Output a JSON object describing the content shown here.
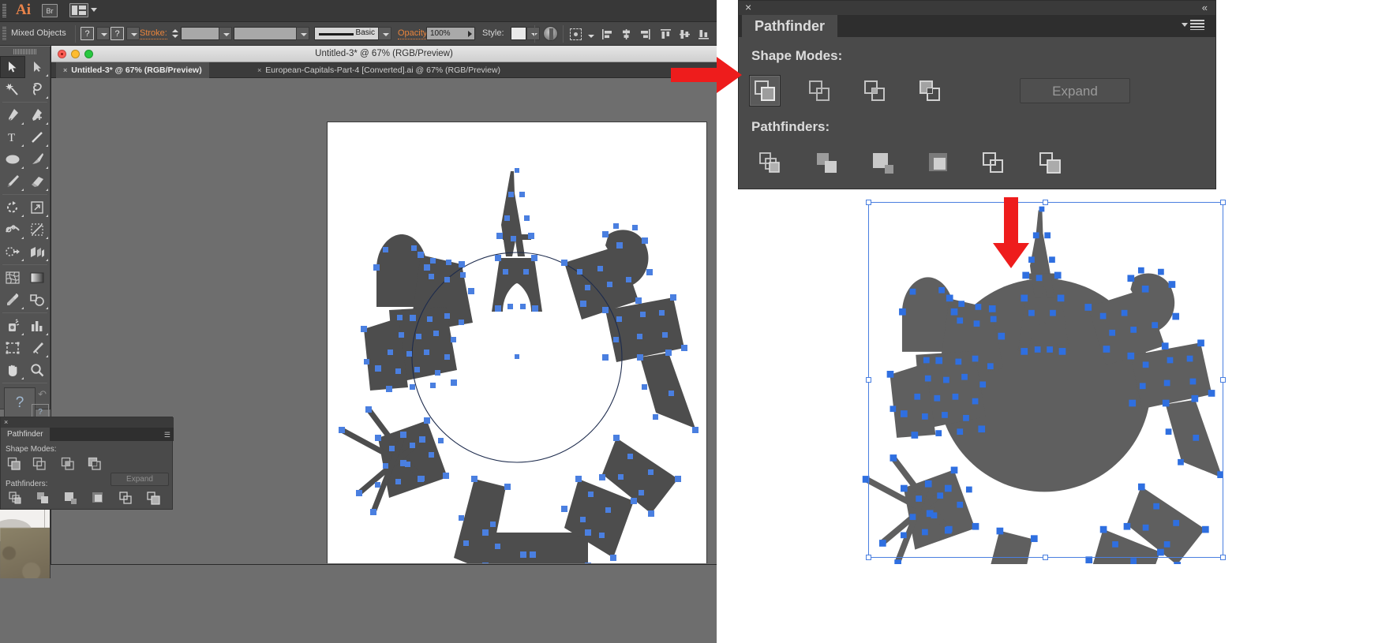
{
  "app": {
    "name": "Ai",
    "bridge_badge": "Br",
    "workspace_switcher": "workspace-switcher"
  },
  "control_bar": {
    "selection_label": "Mixed Objects",
    "fill_value": "?",
    "stroke_swatch_value": "?",
    "stroke_label": "Stroke:",
    "stroke_weight": "",
    "stroke_profile_label": "Basic",
    "opacity_label": "Opacity:",
    "opacity_value": "100%",
    "style_label": "Style:",
    "recolor_artwork": "recolor-artwork",
    "transform_label": "transform",
    "align_left": "align-left",
    "align_center": "align-center",
    "align_right": "align-right",
    "distribute_top": "distribute-top",
    "distribute_center": "distribute-center",
    "distribute_bottom": "distribute-bottom"
  },
  "document": {
    "title": "Untitled-3* @ 67% (RGB/Preview)",
    "tabs": [
      {
        "label": "Untitled-3* @ 67% (RGB/Preview)",
        "active": true,
        "close": "×"
      },
      {
        "label": "European-Capitals-Part-4 [Converted].ai @ 67% (RGB/Preview)",
        "active": false,
        "close": "×"
      }
    ]
  },
  "tools": [
    {
      "name": "selection-tool",
      "selected": true
    },
    {
      "name": "direct-selection-tool",
      "selected": false
    },
    {
      "name": "magic-wand-tool",
      "selected": false
    },
    {
      "name": "lasso-tool",
      "selected": false
    },
    {
      "name": "pen-tool",
      "selected": false
    },
    {
      "name": "add-anchor-point-tool",
      "selected": false
    },
    {
      "name": "type-tool",
      "selected": false
    },
    {
      "name": "line-segment-tool",
      "selected": false
    },
    {
      "name": "ellipse-tool",
      "selected": false
    },
    {
      "name": "paintbrush-tool",
      "selected": false
    },
    {
      "name": "pencil-tool",
      "selected": false
    },
    {
      "name": "eraser-tool",
      "selected": false
    },
    {
      "name": "rotate-tool",
      "selected": false
    },
    {
      "name": "scale-tool",
      "selected": false
    },
    {
      "name": "width-tool",
      "selected": false
    },
    {
      "name": "free-transform-tool",
      "selected": false
    },
    {
      "name": "shape-builder-tool",
      "selected": false
    },
    {
      "name": "perspective-grid-tool",
      "selected": false
    },
    {
      "name": "mesh-tool",
      "selected": false
    },
    {
      "name": "gradient-tool",
      "selected": false
    },
    {
      "name": "eyedropper-tool",
      "selected": false
    },
    {
      "name": "blend-tool",
      "selected": false
    },
    {
      "name": "symbol-sprayer-tool",
      "selected": false
    },
    {
      "name": "column-graph-tool",
      "selected": false
    },
    {
      "name": "artboard-tool",
      "selected": false
    },
    {
      "name": "slice-tool",
      "selected": false
    },
    {
      "name": "hand-tool",
      "selected": false
    },
    {
      "name": "zoom-tool",
      "selected": false
    }
  ],
  "tool_extras": {
    "fill_unknown": "?",
    "stroke_unknown": "?",
    "stroke_unknown_2": "?",
    "stroke_unknown_3": "?"
  },
  "pathfinder_small": {
    "close": "×",
    "tab_label": "Pathfinder",
    "shape_modes_label": "Shape Modes:",
    "pathfinders_label": "Pathfinders:",
    "expand_label": "Expand",
    "shape_mode_buttons": [
      "unite",
      "minus-front",
      "intersect",
      "exclude"
    ],
    "pathfinder_buttons": [
      "divide",
      "trim",
      "merge",
      "crop",
      "outline",
      "minus-back"
    ]
  },
  "pathfinder_big": {
    "close": "×",
    "collapse": "«",
    "tab_label": "Pathfinder",
    "shape_modes_label": "Shape Modes:",
    "pathfinders_label": "Pathfinders:",
    "expand_label": "Expand",
    "shape_mode_buttons": [
      {
        "name": "unite",
        "selected": true
      },
      {
        "name": "minus-front",
        "selected": false
      },
      {
        "name": "intersect",
        "selected": false
      },
      {
        "name": "exclude",
        "selected": false
      }
    ],
    "pathfinder_buttons": [
      "divide",
      "trim",
      "merge",
      "crop",
      "outline",
      "minus-back"
    ]
  },
  "annotations": {
    "arrow_to_panel": "red-arrow-right",
    "arrow_to_result": "red-arrow-down",
    "arrow_color": "#ee1c1c"
  },
  "artwork": {
    "title": "european-capitals-circle",
    "before_description": "Blue-stroked selected landmark silhouettes arranged around an unfilled circle path",
    "after_description": "Same landmarks unioned with a filled gray circle",
    "path_color": "#4a7fe0",
    "shape_fill_before": "#ffffff",
    "shape_fill_after": "#5f5f5f",
    "silhouette_color": "#4d4d4d"
  },
  "colors": {
    "panel_bg": "#4a4a4a",
    "panel_dark": "#2e2e2e",
    "toolbar_bg": "#535353",
    "canvas_bg": "#6e6e6e",
    "accent_orange": "#e8843c",
    "selection_blue": "#4a7fe0",
    "red_arrow": "#ee1c1c"
  }
}
